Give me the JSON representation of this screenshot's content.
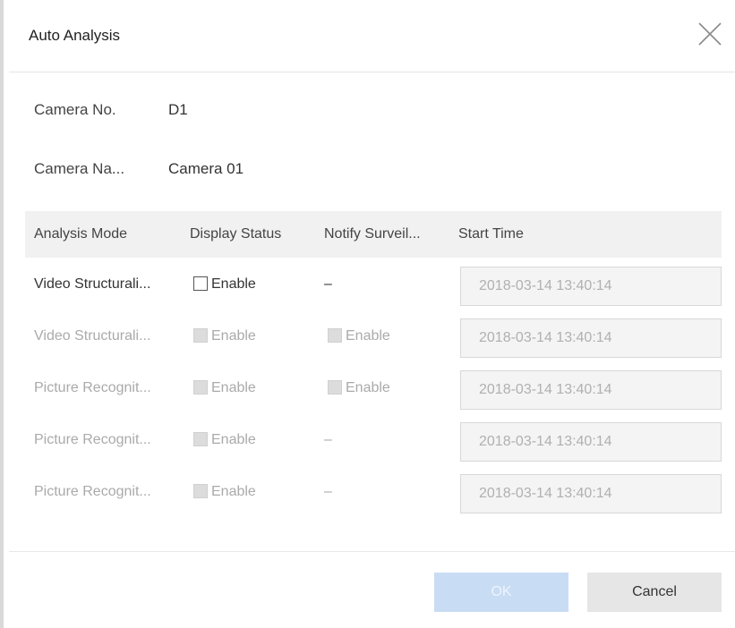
{
  "dialog": {
    "title": "Auto Analysis"
  },
  "fields": {
    "camera_no_label": "Camera No.",
    "camera_no_value": "D1",
    "camera_name_label": "Camera Na...",
    "camera_name_value": "Camera 01"
  },
  "table": {
    "headers": [
      "Analysis Mode",
      "Display Status",
      "Notify Surveil...",
      "Start Time"
    ],
    "rows": [
      {
        "mode": "Video Structurali...",
        "display": "Enable",
        "notify": "–",
        "start_time": "2018-03-14 13:40:14",
        "enabled": true
      },
      {
        "mode": "Video Structurali...",
        "display": "Enable",
        "notify": "Enable",
        "start_time": "2018-03-14 13:40:14",
        "enabled": false
      },
      {
        "mode": "Picture Recognit...",
        "display": "Enable",
        "notify": "Enable",
        "start_time": "2018-03-14 13:40:14",
        "enabled": false
      },
      {
        "mode": "Picture Recognit...",
        "display": "Enable",
        "notify": "–",
        "start_time": "2018-03-14 13:40:14",
        "enabled": false
      },
      {
        "mode": "Picture Recognit...",
        "display": "Enable",
        "notify": "–",
        "start_time": "2018-03-14 13:40:14",
        "enabled": false
      }
    ]
  },
  "footer": {
    "ok_label": "OK",
    "cancel_label": "Cancel"
  },
  "colors": {
    "ok_button": "#c8dcf4",
    "cancel_button": "#e6e6e6",
    "header_bg": "#f1f1f1"
  }
}
